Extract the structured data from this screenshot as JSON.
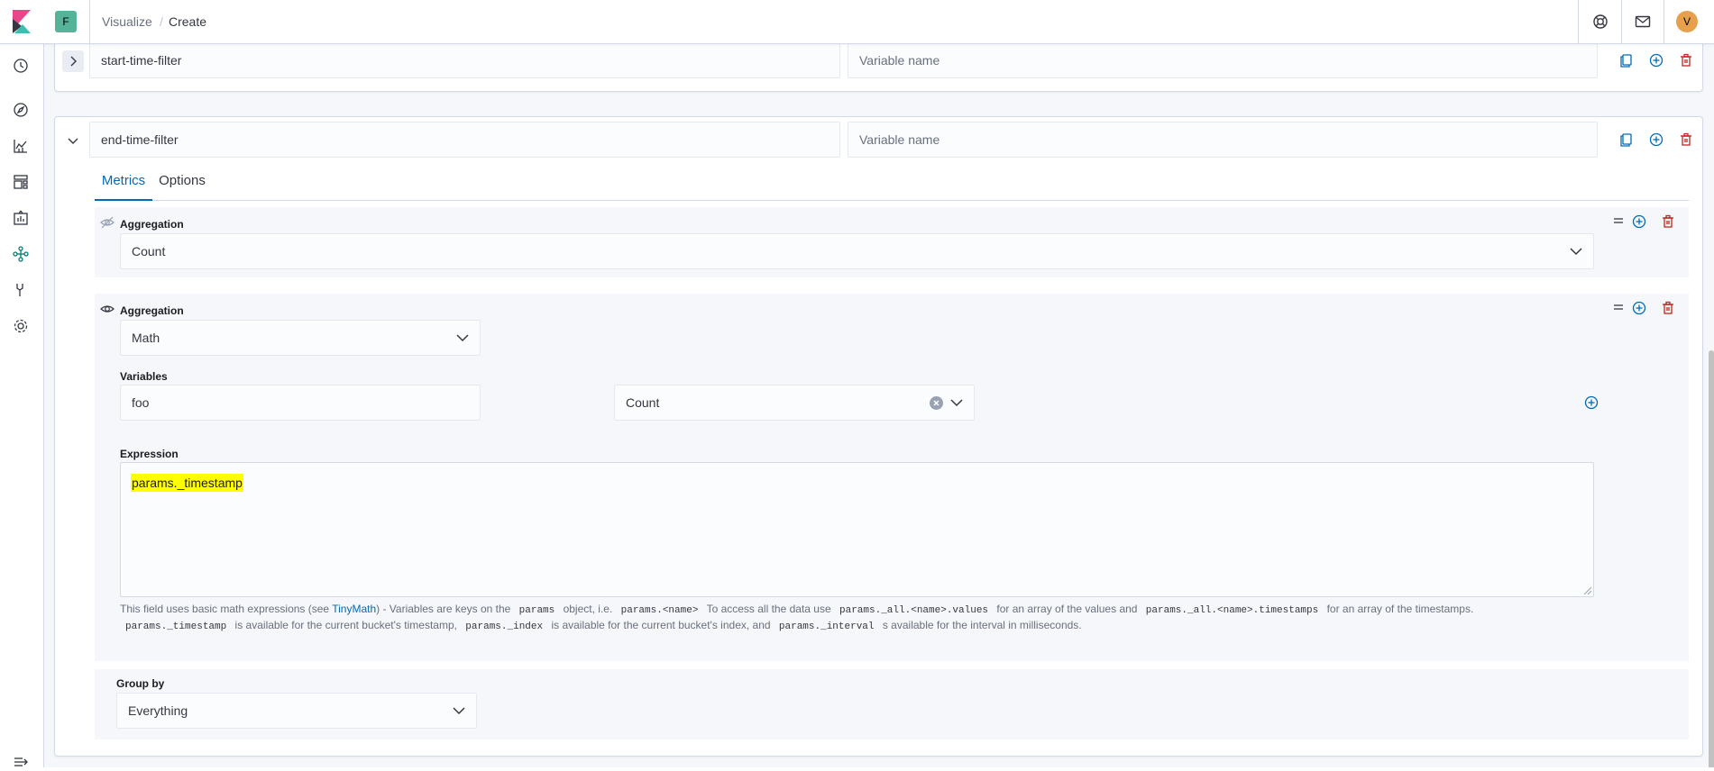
{
  "header": {
    "space_initial": "F",
    "breadcrumbs": [
      "Visualize",
      "Create"
    ],
    "breadcrumb_separator": "/",
    "user_initial": "V"
  },
  "colors": {
    "accent": "#006bb4",
    "danger": "#bd271e",
    "highlight": "#ffff00",
    "space_avatar": "#54b399",
    "user_avatar": "#e7a14c"
  },
  "side_nav": [
    "recently-viewed-icon",
    "discover-icon",
    "visualize-icon",
    "dashboard-icon",
    "canvas-icon",
    "graph-icon",
    "dev-tools-icon",
    "management-icon",
    "collapse-menu-icon"
  ],
  "series": [
    {
      "label_value": "start-time-filter",
      "variable_placeholder": "Variable name",
      "expanded": false
    },
    {
      "label_value": "end-time-filter",
      "variable_placeholder": "Variable name",
      "expanded": true,
      "tabs": [
        "Metrics",
        "Options"
      ],
      "active_tab": "Metrics",
      "aggregations": [
        {
          "label": "Aggregation",
          "value": "Count",
          "visible": false
        },
        {
          "label": "Aggregation",
          "value": "Math",
          "visible": true,
          "variables_label": "Variables",
          "variable_name": "foo",
          "variable_metric": "Count",
          "expression_label": "Expression",
          "expression": "params._timestamp",
          "help": {
            "t1": "This field uses basic math expressions (see ",
            "link": "TinyMath",
            "t2": ") - Variables are keys on the ",
            "c1": "params",
            "t3": " object, i.e. ",
            "c2": "params.<name>",
            "t4": " To access all the data use ",
            "c3": "params._all.<name>.values",
            "t5": " for an array of the values and ",
            "c4": "params._all.<name>.timestamps",
            "t6": " for an array of the timestamps.",
            "c5": "params._timestamp",
            "t7": " is available for the current bucket's timestamp, ",
            "c6": "params._index",
            "t8": " is available for the current bucket's index, and ",
            "c7": "params._interval",
            "t9": " s available for the interval in milliseconds."
          }
        }
      ],
      "group_by_label": "Group by",
      "group_by_value": "Everything"
    }
  ]
}
